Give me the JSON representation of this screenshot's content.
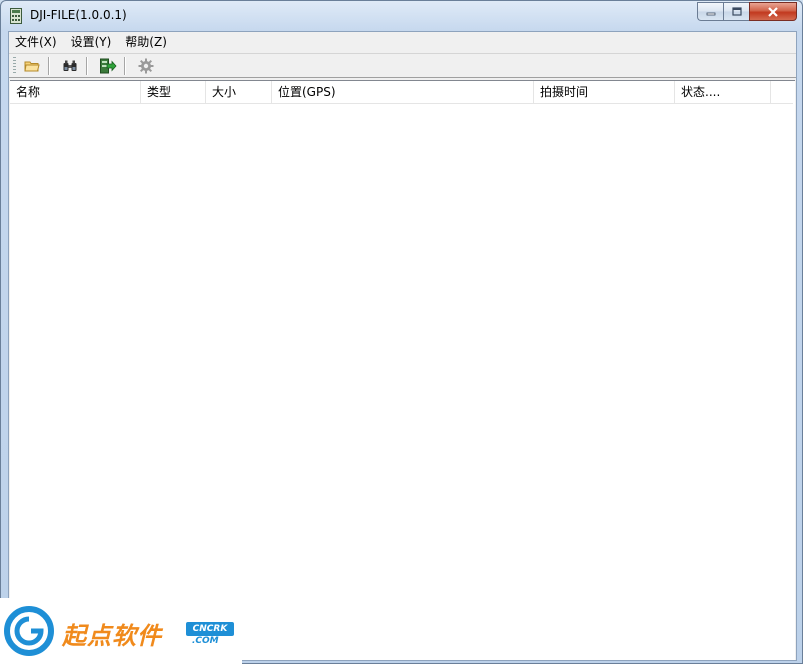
{
  "window": {
    "title": "DJI-FILE(1.0.0.1)"
  },
  "menubar": {
    "items": [
      {
        "label": "文件(X)"
      },
      {
        "label": "设置(Y)"
      },
      {
        "label": "帮助(Z)"
      }
    ]
  },
  "toolbar": {
    "buttons": [
      {
        "icon": "folder-open-icon"
      },
      {
        "icon": "binoculars-icon"
      },
      {
        "icon": "export-icon"
      },
      {
        "icon": "gear-icon"
      }
    ]
  },
  "list": {
    "columns": [
      {
        "label": "名称"
      },
      {
        "label": "类型"
      },
      {
        "label": "大小"
      },
      {
        "label": "位置(GPS)"
      },
      {
        "label": "拍摄时间"
      },
      {
        "label": "状态...."
      }
    ],
    "rows": []
  },
  "watermark": {
    "brand": "起点软件",
    "badge": "CNCRK",
    "domain": ".COM"
  },
  "colors": {
    "title_bar": "#c6d8ee",
    "close_button": "#c2391f",
    "watermark_orange": "#f08a1c",
    "watermark_blue": "#1e8fd6"
  }
}
